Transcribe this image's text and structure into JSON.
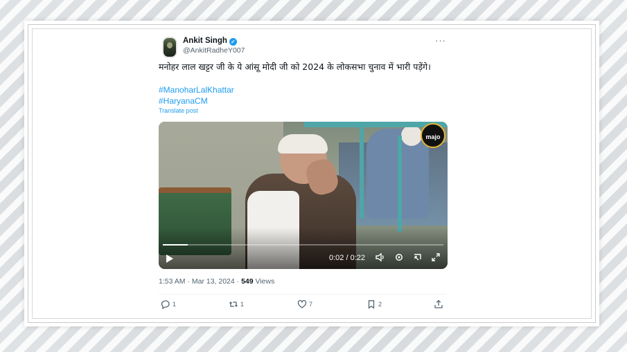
{
  "tweet": {
    "author_name": "Ankit Singh",
    "handle": "@AnkitRadheY007",
    "more_label": "···",
    "text": "मनोहर लाल खट्टर जी के ये आंसू मोदी जी को 2024 के लोकसभा चुनाव में भारी पड़ेंगे।",
    "hashtags": [
      "#ManoharLalKhattar",
      "#HaryanaCM"
    ],
    "translate_label": "Translate post",
    "video": {
      "channel_logo": "majo",
      "time": "0:02 / 0:22",
      "progress": 0.09
    },
    "timestamp": "1:53 AM · Mar 13, 2024 · ",
    "views_count": "549",
    "views_label": " Views",
    "stats": {
      "replies": "1",
      "reposts": "1",
      "likes": "7",
      "bookmarks": "2"
    }
  },
  "icons": {
    "verified": "verified-badge-icon",
    "play": "play-icon",
    "volume": "volume-icon",
    "settings": "settings-gear-icon",
    "pip": "picture-in-picture-icon",
    "fullscreen": "fullscreen-icon",
    "reply": "reply-icon",
    "repost": "repost-icon",
    "like": "like-heart-icon",
    "bookmark": "bookmark-icon",
    "share": "share-icon"
  },
  "colors": {
    "accent": "#1d9bf0",
    "text_primary": "#0f1419",
    "text_secondary": "#536471"
  }
}
